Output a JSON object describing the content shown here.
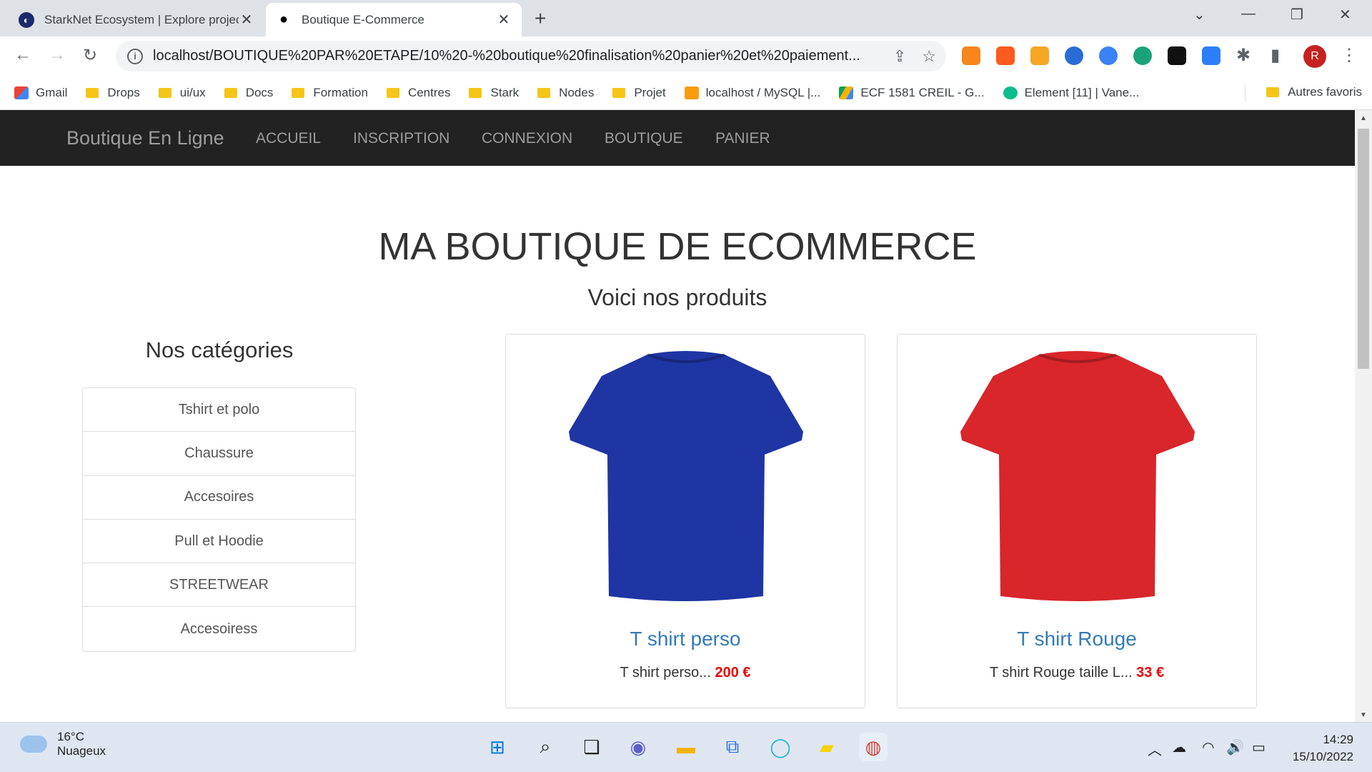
{
  "browser": {
    "tabs": [
      {
        "title": "StarkNet Ecosystem | Explore projects",
        "active": false
      },
      {
        "title": "Boutique E-Commerce",
        "active": true
      }
    ],
    "url": "localhost/BOUTIQUE%20PAR%20ETAPE/10%20-%20boutique%20finalisation%20panier%20et%20paiement...",
    "bookmarks": [
      "Gmail",
      "Drops",
      "ui/ux",
      "Docs",
      "Formation",
      "Centres",
      "Stark",
      "Nodes",
      "Projet",
      "localhost / MySQL |...",
      "ECF 1581 CREIL - G...",
      "Element [11] | Vane..."
    ],
    "other_bookmarks": "Autres favoris",
    "profile_initial": "R"
  },
  "site": {
    "brand": "Boutique En Ligne",
    "nav": [
      "ACCUEIL",
      "INSCRIPTION",
      "CONNEXION",
      "BOUTIQUE",
      "PANIER"
    ],
    "title": "MA BOUTIQUE DE ECOMMERCE",
    "subtitle": "Voici nos produits",
    "categories_title": "Nos catégories",
    "categories": [
      "Tshirt et polo",
      "Chaussure",
      "Accesoires",
      "Pull et Hoodie",
      "STREETWEAR",
      "Accesoiress"
    ],
    "products": [
      {
        "name": "T shirt perso",
        "desc": "T shirt perso...",
        "price": "200 €",
        "color": "#1f35a3"
      },
      {
        "name": "T shirt Rouge",
        "desc": "T shirt Rouge taille L...",
        "price": "33 €",
        "color": "#d8262b"
      }
    ]
  },
  "taskbar": {
    "temperature": "16°C",
    "weather": "Nuageux",
    "time": "14:29",
    "date": "15/10/2022"
  }
}
